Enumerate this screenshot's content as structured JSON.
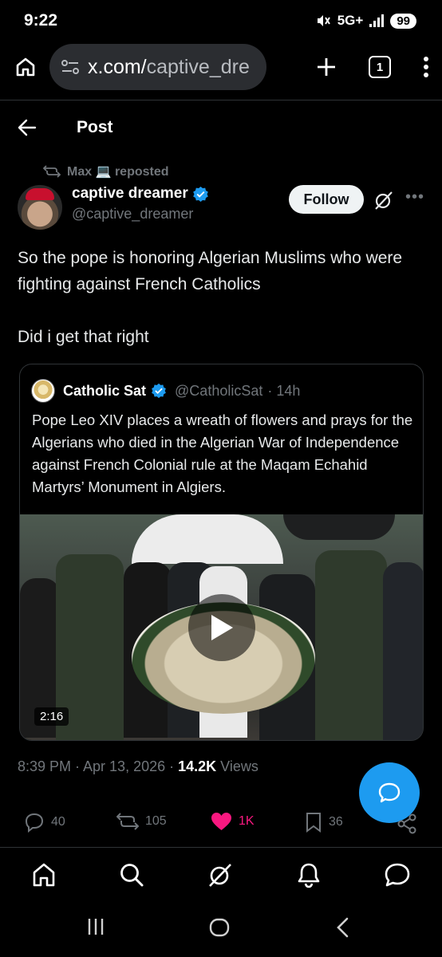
{
  "status_bar": {
    "time": "9:22",
    "network": "5G+",
    "battery": "99"
  },
  "browser": {
    "url_host": "x.com/",
    "url_path": "captive_dre",
    "tab_count": "1"
  },
  "header": {
    "title": "Post"
  },
  "repost": {
    "text": "Max 💻 reposted"
  },
  "author": {
    "name": "captive dreamer",
    "handle": "@captive_dreamer",
    "verified": true,
    "follow_label": "Follow"
  },
  "tweet": {
    "line1": "So the pope is honoring Algerian Muslims who were fighting against French Catholics",
    "line2": "Did i get that right"
  },
  "quote": {
    "name": "Catholic Sat",
    "handle": "@CatholicSat",
    "time": "· 14h",
    "text": "Pope Leo XIV places a wreath of flowers and prays for the Algerians who died in the Algerian War of Independence against French Colonial rule at the Maqam Echahid Martyrs’ Monument in Algiers.",
    "video_duration": "2:16"
  },
  "meta": {
    "timestamp": "8:39 PM · Apr 13, 2026 · ",
    "views_count": "14.2K",
    "views_label": " Views"
  },
  "actions": {
    "replies": "40",
    "reposts": "105",
    "likes": "1K",
    "bookmarks": "36"
  },
  "colors": {
    "accent": "#1d9bf0",
    "like": "#f91880",
    "muted": "#71767b",
    "background": "#000000"
  },
  "icons": {
    "nav": [
      "home-icon",
      "search-icon",
      "grok-icon",
      "notifications-icon",
      "messages-icon"
    ]
  }
}
